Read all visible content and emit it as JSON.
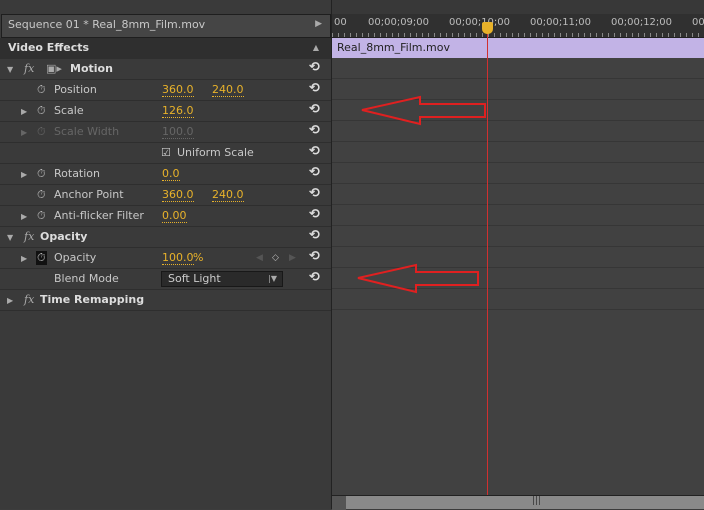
{
  "panel": {
    "sequence_title": "Sequence 01 * Real_8mm_Film.mov",
    "section": "Video Effects"
  },
  "effects": [
    {
      "name": "Motion",
      "type": "fx"
    },
    {
      "name": "Position",
      "values": [
        "360.0",
        "240.0"
      ]
    },
    {
      "name": "Scale",
      "values": [
        "126.0"
      ]
    },
    {
      "name": "Scale Width",
      "values": [
        "100.0"
      ],
      "disabled": true
    },
    {
      "name": "Uniform Scale",
      "checked": true
    },
    {
      "name": "Rotation",
      "values": [
        "0.0"
      ]
    },
    {
      "name": "Anchor Point",
      "values": [
        "360.0",
        "240.0"
      ]
    },
    {
      "name": "Anti-flicker Filter",
      "values": [
        "0.00"
      ]
    },
    {
      "name": "Opacity",
      "type": "fx"
    },
    {
      "name": "Opacity",
      "values": [
        "100.0"
      ],
      "unit": "%"
    },
    {
      "name": "Blend Mode",
      "selected": "Soft Light"
    },
    {
      "name": "Time Remapping",
      "type": "fx"
    }
  ],
  "timeline": {
    "ticks": [
      "00",
      "00;00;09;00",
      "00;00;10;00",
      "00;00;11;00",
      "00;00;12;00",
      "00;"
    ],
    "clip": "Real_8mm_Film.mov"
  },
  "colors": {
    "value": "#e8b22a",
    "clip": "#c2b3e6",
    "playhead": "#d03030",
    "annotation_arrow": "#e02020"
  }
}
